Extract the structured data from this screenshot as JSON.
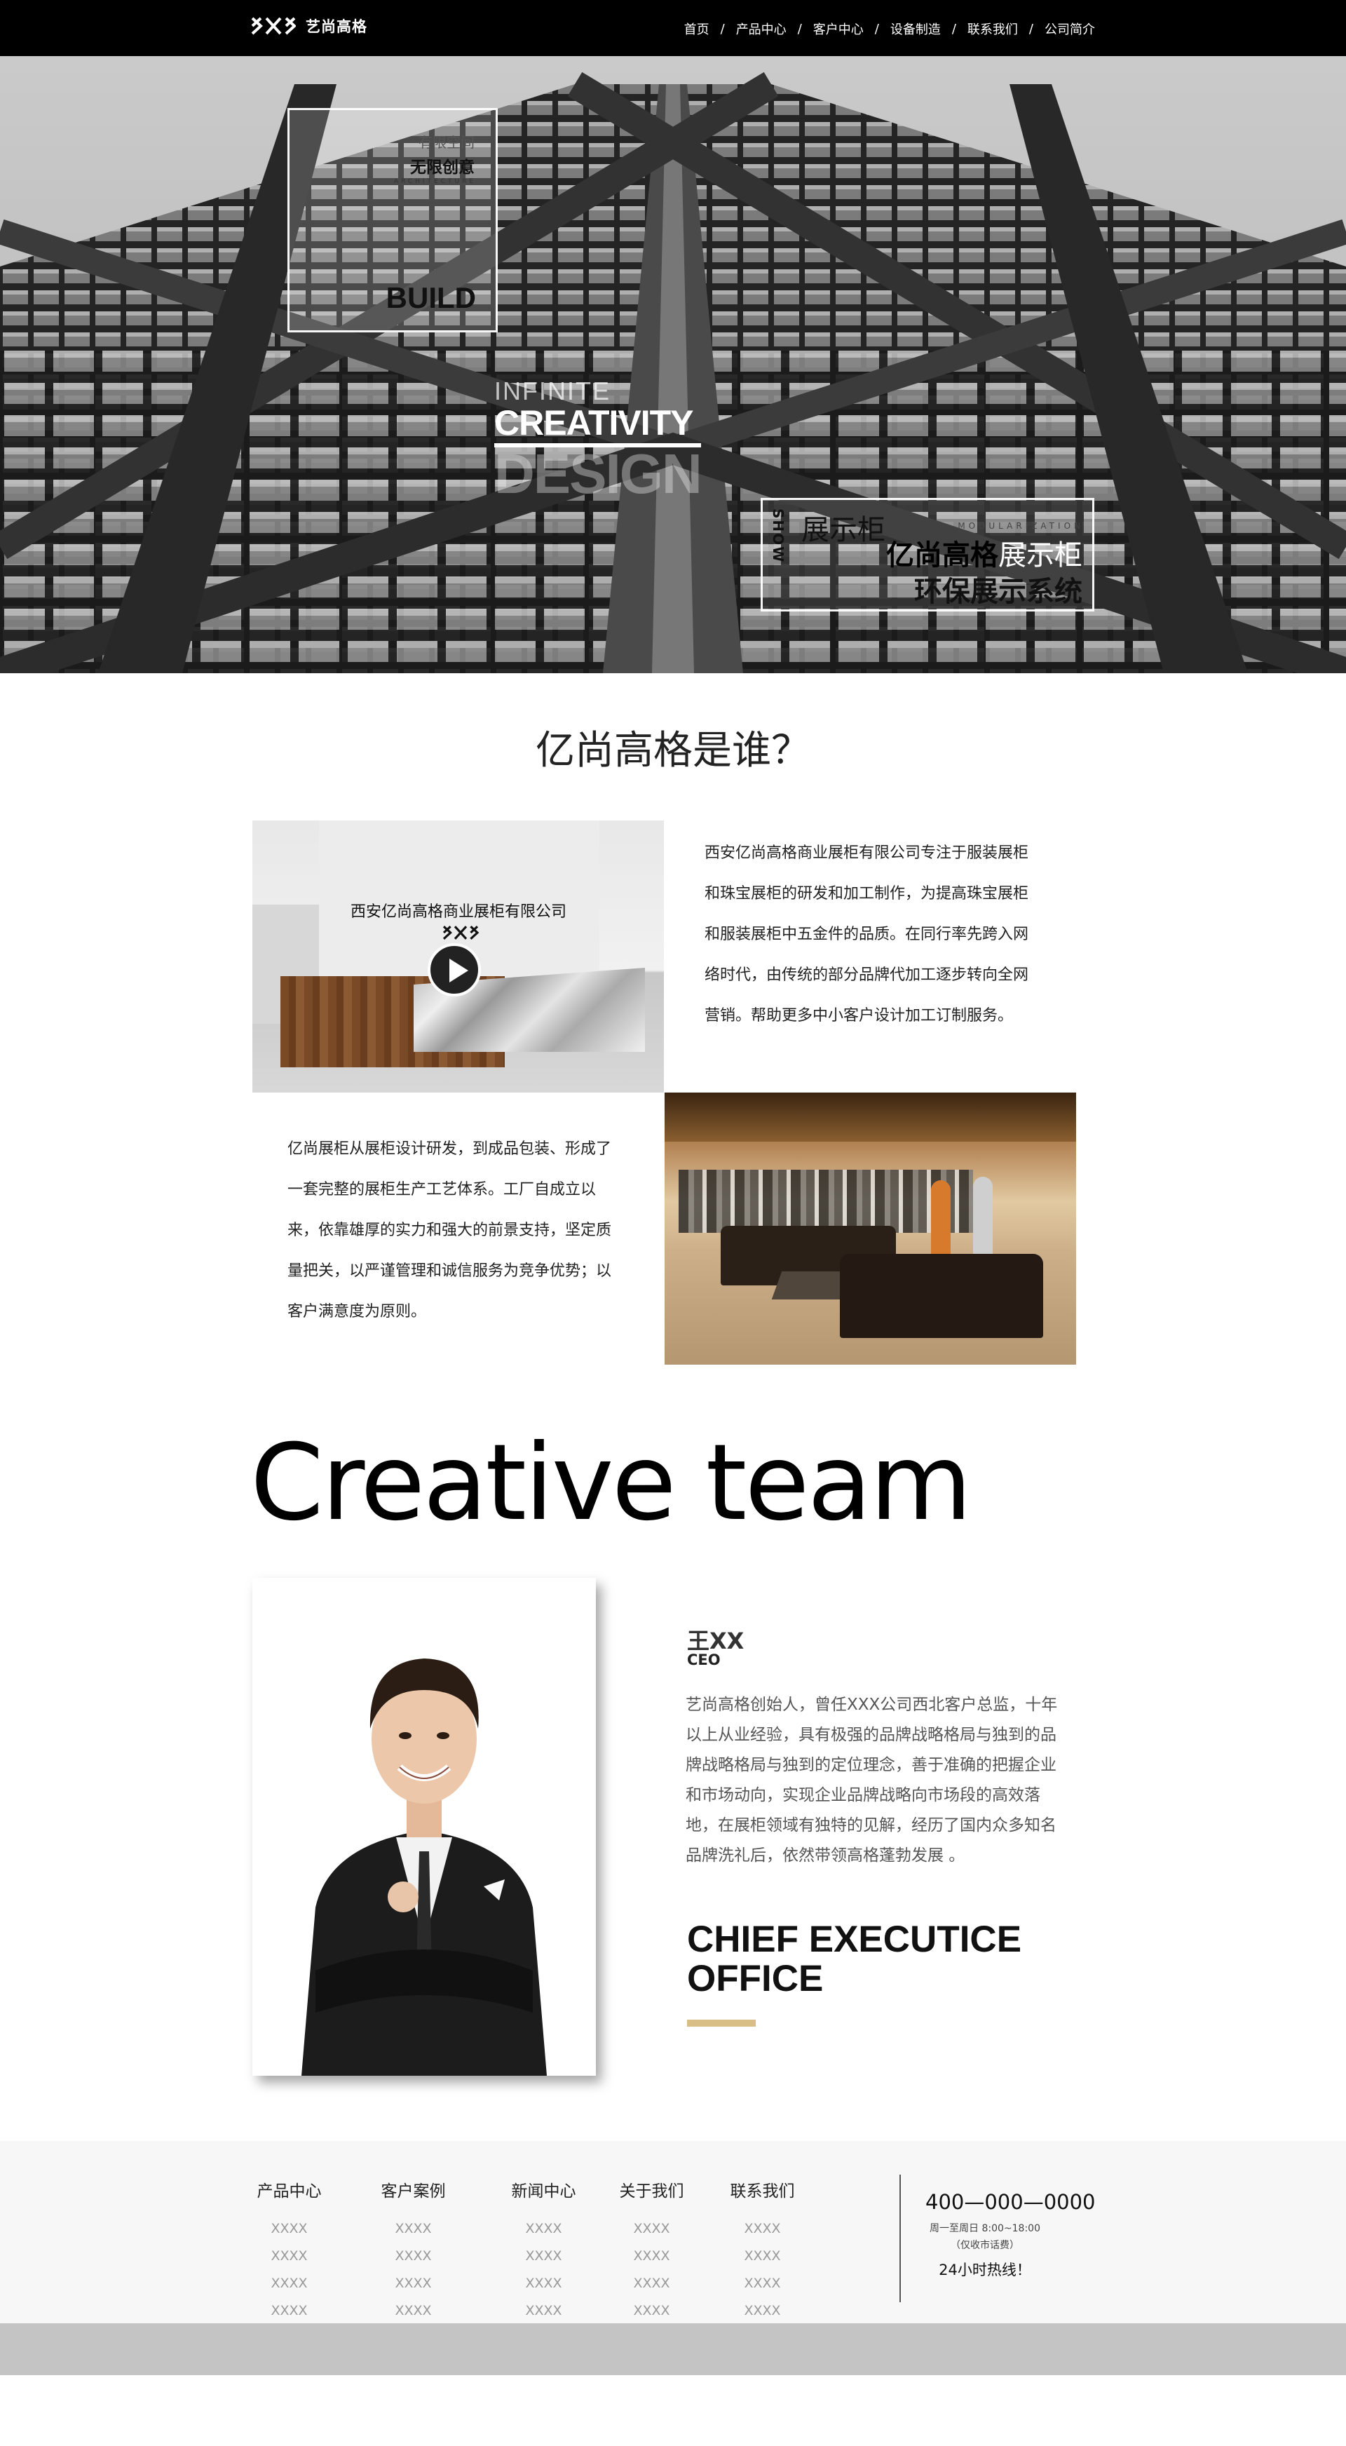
{
  "brand": {
    "name": "艺尚高格"
  },
  "nav": [
    "首页",
    "产品中心",
    "客户中心",
    "设备制造",
    "联系我们",
    "公司简介"
  ],
  "hero": {
    "box1_small": "有限空间",
    "box1_big": "无限创意",
    "box1_arch": "ARCHITECTURE",
    "box1_build": "BUILD",
    "infinite": "INFINITE",
    "creativity": "CREATIVITY",
    "design": "DESIGN",
    "show": "SHOW",
    "line1": "展示柜",
    "modularization": "MODULARIZATION",
    "line2_bold": "亿尚高格",
    "line2_rest": "展示柜",
    "line3": "环保展示系统"
  },
  "about": {
    "title": "亿尚高格是谁？",
    "office_sign": "西安亿尚高格商业展柜有限公司",
    "text1": "西安亿尚高格商业展柜有限公司专注于服装展柜和珠宝展柜的研发和加工制作，为提高珠宝展柜和服装展柜中五金件的品质。在同行率先跨入网络时代，由传统的部分品牌代加工逐步转向全网营销。帮助更多中小客户设计加工订制服务。",
    "text2": "亿尚展柜从展柜设计研发，到成品包装、形成了一套完整的展柜生产工艺体系。工厂自成立以来，依靠雄厚的实力和强大的前景支持，坚定质量把关，以严谨管理和诚信服务为竞争优势；以客户满意度为原则。"
  },
  "team": {
    "title": "Creative team",
    "name": "王XX",
    "role": "CEO",
    "bio": "艺尚高格创始人，曾任XXX公司西北客户总监，十年以上从业经验，具有极强的品牌战略格局与独到的品牌战略格局与独到的定位理念，善于准确的把握企业和市场动向，实现企业品牌战略向市场段的高效落地，在展柜领域有独特的见解，经历了国内众多知名品牌洗礼后，依然带领高格蓬勃发展 。",
    "title_line1": "CHIEF EXECUTICE",
    "title_line2": "OFFICE",
    "accent_color": "#d8bd84"
  },
  "footer": {
    "columns": [
      {
        "heading": "产品中心",
        "links": [
          "XXXX",
          "XXXX",
          "XXXX",
          "XXXX"
        ]
      },
      {
        "heading": "客户案例",
        "links": [
          "XXXX",
          "XXXX",
          "XXXX",
          "XXXX"
        ]
      },
      {
        "heading": "新闻中心",
        "links": [
          "XXXX",
          "XXXX",
          "XXXX",
          "XXXX"
        ]
      },
      {
        "heading": "关于我们",
        "links": [
          "XXXX",
          "XXXX",
          "XXXX",
          "XXXX"
        ]
      },
      {
        "heading": "联系我们",
        "links": [
          "XXXX",
          "XXXX",
          "XXXX",
          "XXXX"
        ]
      }
    ],
    "phone": "400—000—0000",
    "hours": "周一至周日 8:00~18:00",
    "fee": "（仅收市话费）",
    "hotline": "24小时热线！"
  }
}
